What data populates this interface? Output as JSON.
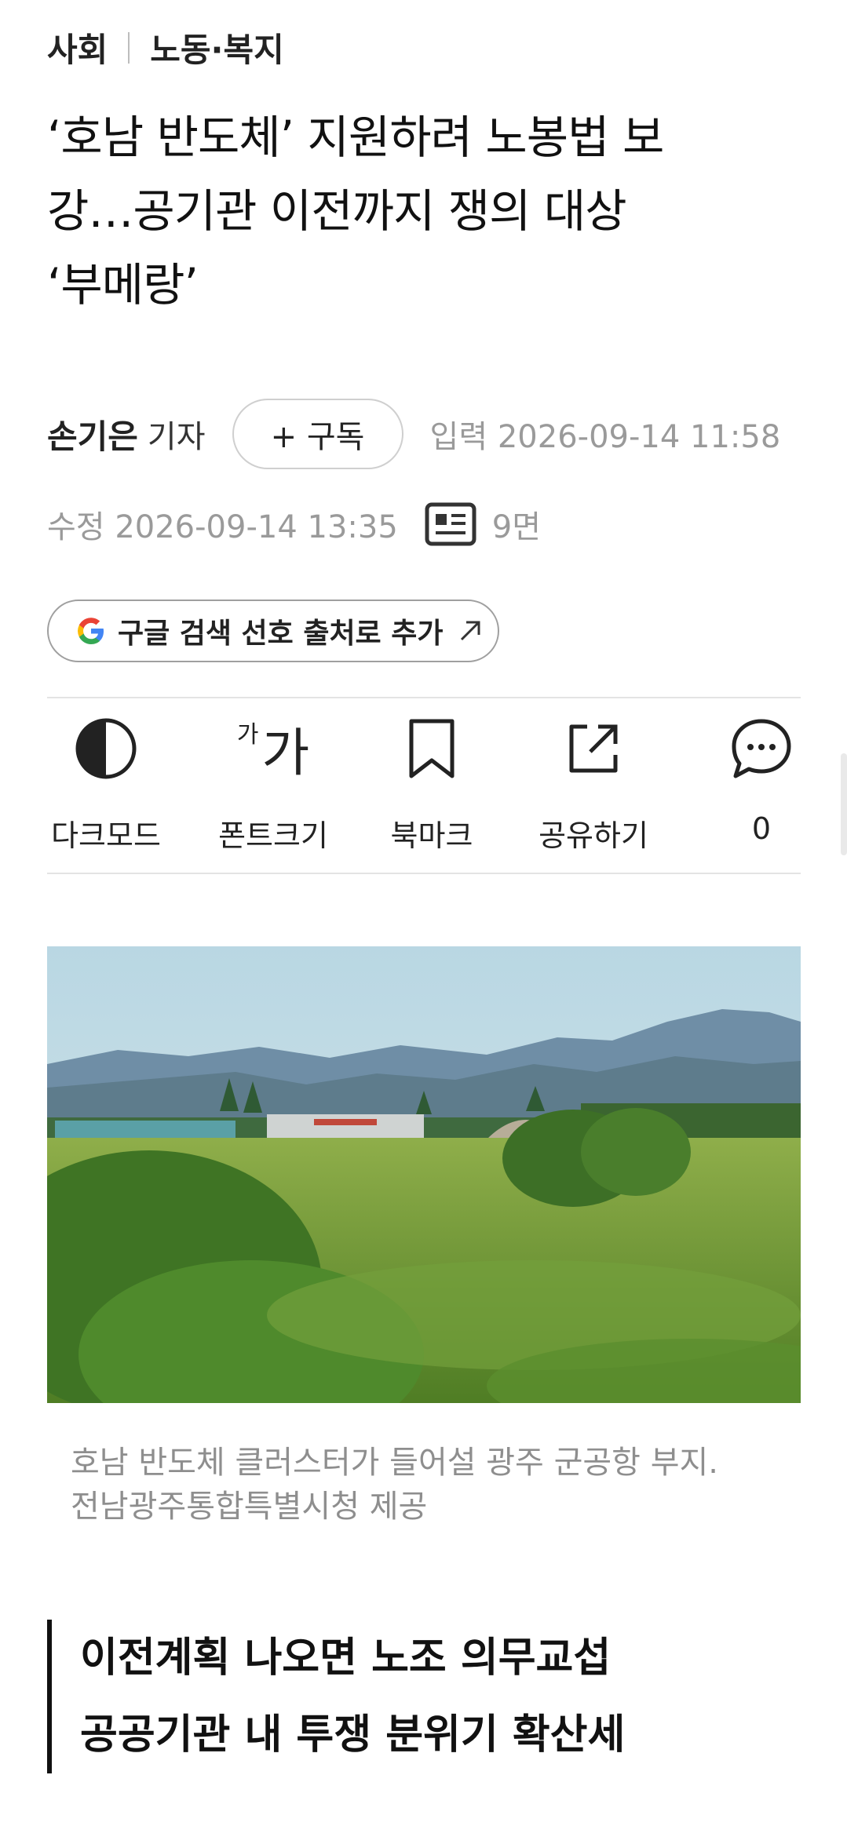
{
  "breadcrumb": {
    "section": "사회",
    "subsection": "노동·복지"
  },
  "article": {
    "headline_line1": "‘호남 반도체’ 지원하려 노봉법 보",
    "headline_line2": "강…공기관 이전까지 쟁의 대상",
    "headline_line3": "‘부메랑’",
    "reporter_name": "손기은",
    "reporter_role": "기자",
    "subscribe_label": "+ 구독",
    "input_label": "입력 2026-09-14 11:58",
    "modified_label": "수정 2026-09-14 13:35",
    "page_label": "9면",
    "google_label": "구글 검색 선호 출처로 추가"
  },
  "toolbar": {
    "darkmode_label": "다크모드",
    "fontsize_small": "가",
    "fontsize_big": "가",
    "fontsize_label": "폰트크기",
    "bookmark_label": "북마크",
    "share_label": "공유하기",
    "comment_count": "0"
  },
  "photo": {
    "caption_line1": "호남 반도체 클러스터가 들어설 광주 군공항 부지.",
    "caption_line2": "전남광주통합특별시청 제공"
  },
  "subheading": {
    "line1": "이전계획 나오면 노조 의무교섭",
    "line2": "공공기관 내 투쟁 분위기 확산세"
  },
  "colors": {
    "text": "#111111",
    "muted": "#9a9a9a",
    "divider": "#e3e3e3"
  },
  "icons": [
    "google-g-icon",
    "external-arrow-icon",
    "newspaper-icon",
    "darkmode-icon",
    "bookmark-icon",
    "share-icon",
    "comment-icon"
  ]
}
